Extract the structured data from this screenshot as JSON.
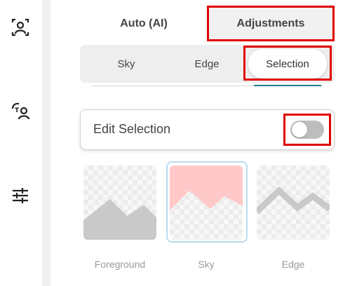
{
  "rail": {
    "icons": [
      "portrait-icon",
      "ai-swap-icon",
      "sliders-icon"
    ]
  },
  "top_tabs": [
    {
      "label": "Auto (AI)",
      "selected": false
    },
    {
      "label": "Adjustments",
      "selected": true
    }
  ],
  "sub_tabs": [
    {
      "label": "Sky",
      "selected": false
    },
    {
      "label": "Edge",
      "selected": false
    },
    {
      "label": "Selection",
      "selected": true
    }
  ],
  "edit_selection": {
    "label": "Edit Selection",
    "enabled": false
  },
  "thumbnails": [
    {
      "label": "Foreground",
      "selected": false
    },
    {
      "label": "Sky",
      "selected": true
    },
    {
      "label": "Edge",
      "selected": false
    }
  ],
  "colors": {
    "highlight": "#e00000",
    "accent_teal": "#1a7f8c",
    "sky_pink": "#ffc9c9",
    "mountain_gray": "#c9c9c9",
    "selected_frame": "#b9dcee"
  }
}
